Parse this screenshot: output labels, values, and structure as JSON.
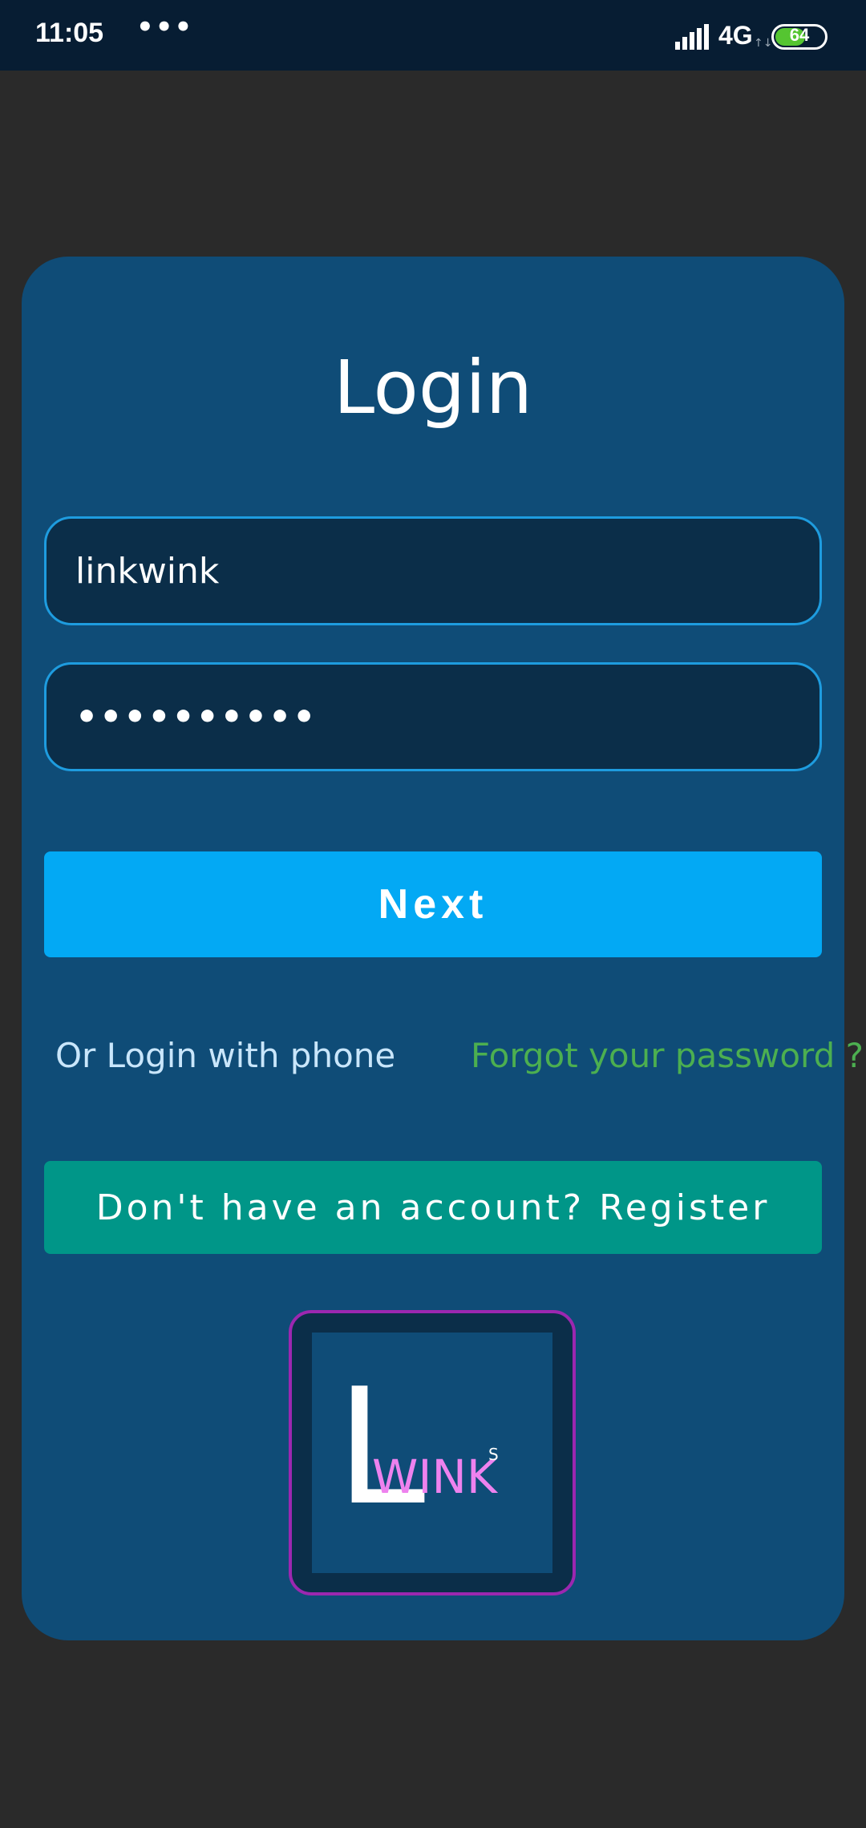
{
  "status_bar": {
    "time": "11:05",
    "dots": "•••",
    "network": "4G",
    "network_arrows": "↑↓",
    "battery_level": "64",
    "battery_fraction": 0.64,
    "signal_icon": "signal-bars-icon",
    "battery_icon": "battery-icon"
  },
  "login": {
    "title": "Login",
    "username_value": "linkwink",
    "password_value": "••••••••••",
    "next_label": "Next",
    "phone_login_label": "Or Login with phone",
    "forgot_password_label": "Forgot your password ?",
    "register_label": "Don't have an account? Register"
  },
  "logo": {
    "letter": "L",
    "word": "WINK",
    "superscript": "S"
  },
  "colors": {
    "card_background": "#0f4c77",
    "field_border": "#1e9cdf",
    "next_button": "#03a9f4",
    "register_button": "#009688",
    "forgot_link": "#4caf50",
    "logo_border": "#9c27b0",
    "logo_word": "#ee82ee"
  }
}
